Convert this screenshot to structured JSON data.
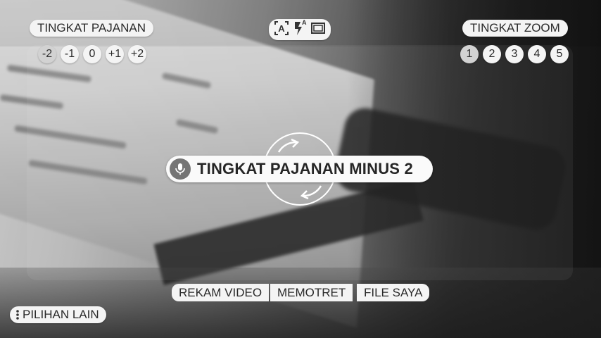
{
  "header": {
    "exposure_label": "TINGKAT PAJANAN",
    "exposure_levels": [
      "-2",
      "-1",
      "0",
      "+1",
      "+2"
    ],
    "exposure_selected": "-2",
    "zoom_label": "TINGKAT ZOOM",
    "zoom_levels": [
      "1",
      "2",
      "3",
      "4",
      "5"
    ],
    "zoom_selected": "1",
    "camera_mode_icons": [
      "auto-scene-icon",
      "flash-auto-icon",
      "aspect-ratio-icon"
    ],
    "flash_badge": "A"
  },
  "voice_banner": {
    "text": "TINGKAT PAJANAN MINUS 2",
    "icon": "microphone-icon"
  },
  "modes": {
    "video": "REKAM VIDEO",
    "photo": "MEMOTRET",
    "files": "FILE SAYA"
  },
  "more_options": {
    "label": "PILIHAN LAIN",
    "icon": "more-vertical-icon"
  },
  "colors": {
    "chip_bg": "#f4f4f4",
    "chip_text": "#2a2a2a",
    "selected_circle": "#d2d2d2",
    "mic_bg": "#757575"
  }
}
